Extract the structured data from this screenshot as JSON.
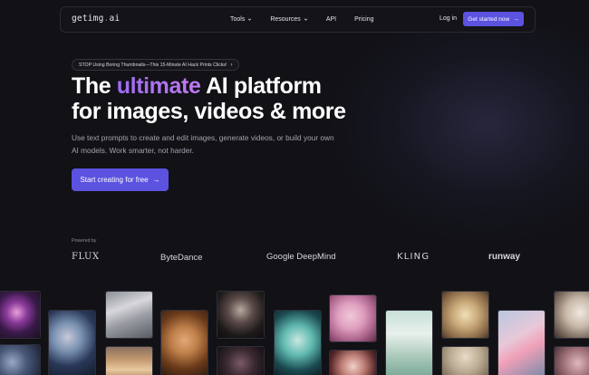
{
  "nav": {
    "logo_main": "getimg",
    "logo_dot": ".",
    "logo_tld": "ai",
    "links": [
      {
        "label": "Tools",
        "dropdown": true
      },
      {
        "label": "Resources",
        "dropdown": true
      },
      {
        "label": "API",
        "dropdown": false
      },
      {
        "label": "Pricing",
        "dropdown": false
      }
    ],
    "login": "Log in",
    "get_started": "Get started now"
  },
  "promo": {
    "text": "STOP Using Boring Thumbnails—This 15-Minute AI Hack Prints Clicks!"
  },
  "hero": {
    "title_pre": "The ",
    "title_highlight": "ultimate",
    "title_post": " AI platform",
    "title_line2": "for images, videos & more",
    "subtitle": "Use text prompts to create and edit images, generate videos, or build your own AI models. Work smarter, not harder.",
    "cta": "Start creating for free"
  },
  "powered_by": {
    "label": "Powered by",
    "brands": [
      "FLUX",
      "ByteDance",
      "Google DeepMind",
      "KLING",
      "runway"
    ]
  },
  "colors": {
    "background": "#111116",
    "accent": "#5b52e0",
    "highlight_gradient_start": "#9c6cf0",
    "highlight_gradient_end": "#c07af2"
  },
  "icons": {
    "chevron": "chevron-down-icon",
    "arrow": "arrow-right-icon"
  }
}
